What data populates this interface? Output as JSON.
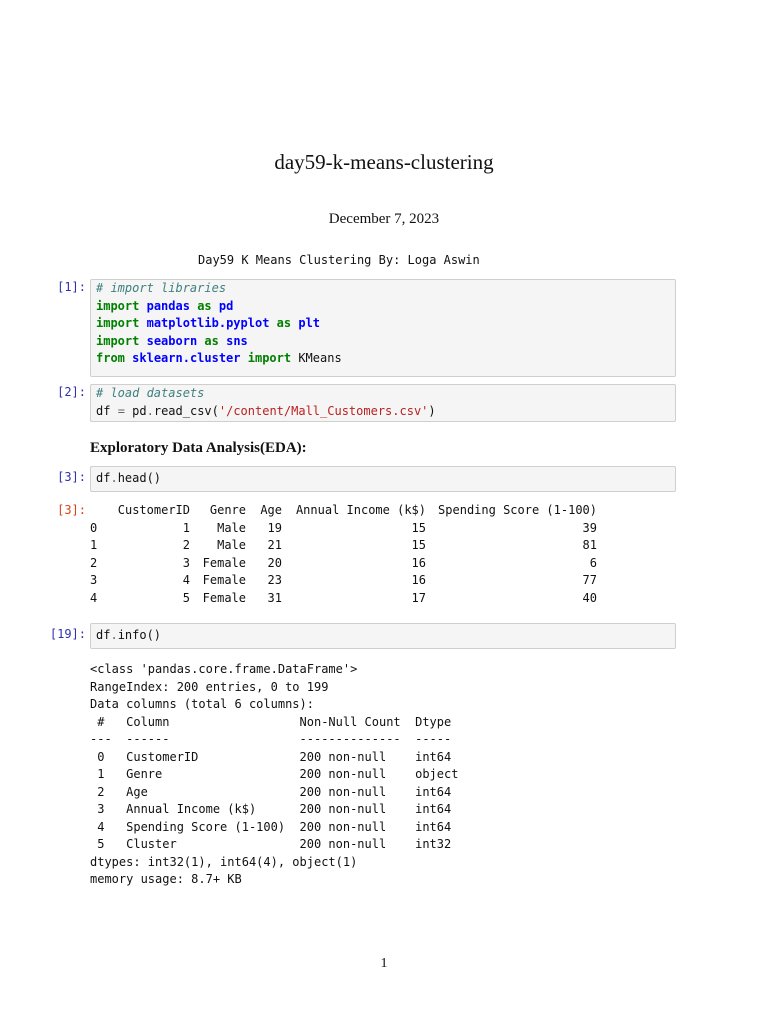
{
  "title": "day59-k-means-clustering",
  "date": "December 7, 2023",
  "intro": "Day59 K Means Clustering By: Loga Aswin",
  "cells": [
    {
      "prompt": "[1]:",
      "lines": [
        [
          {
            "t": "# import libraries",
            "c": "cm"
          }
        ],
        [
          {
            "t": "import",
            "c": "kw"
          },
          {
            "t": " ",
            "c": "tx"
          },
          {
            "t": "pandas",
            "c": "nm"
          },
          {
            "t": " ",
            "c": "tx"
          },
          {
            "t": "as",
            "c": "kw"
          },
          {
            "t": " ",
            "c": "tx"
          },
          {
            "t": "pd",
            "c": "nm"
          }
        ],
        [
          {
            "t": "import",
            "c": "kw"
          },
          {
            "t": " ",
            "c": "tx"
          },
          {
            "t": "matplotlib.pyplot",
            "c": "nm"
          },
          {
            "t": " ",
            "c": "tx"
          },
          {
            "t": "as",
            "c": "kw"
          },
          {
            "t": " ",
            "c": "tx"
          },
          {
            "t": "plt",
            "c": "nm"
          }
        ],
        [
          {
            "t": "import",
            "c": "kw"
          },
          {
            "t": " ",
            "c": "tx"
          },
          {
            "t": "seaborn",
            "c": "nm"
          },
          {
            "t": " ",
            "c": "tx"
          },
          {
            "t": "as",
            "c": "kw"
          },
          {
            "t": " ",
            "c": "tx"
          },
          {
            "t": "sns",
            "c": "nm"
          }
        ],
        [
          {
            "t": "from",
            "c": "kw"
          },
          {
            "t": " ",
            "c": "tx"
          },
          {
            "t": "sklearn.cluster",
            "c": "nm"
          },
          {
            "t": " ",
            "c": "tx"
          },
          {
            "t": "import",
            "c": "kw"
          },
          {
            "t": " KMeans",
            "c": "tx"
          }
        ]
      ]
    },
    {
      "prompt": "[2]:",
      "lines": [
        [
          {
            "t": "# load datasets",
            "c": "cm"
          }
        ],
        [
          {
            "t": "df ",
            "c": "tx"
          },
          {
            "t": "=",
            "c": "op"
          },
          {
            "t": " pd",
            "c": "tx"
          },
          {
            "t": ".",
            "c": "op"
          },
          {
            "t": "read_csv(",
            "c": "tx"
          },
          {
            "t": "'/content/Mall_Customers.csv'",
            "c": "st"
          },
          {
            "t": ")",
            "c": "tx"
          }
        ]
      ]
    },
    {
      "prompt": "[3]:",
      "lines": [
        [
          {
            "t": "df",
            "c": "tx"
          },
          {
            "t": ".",
            "c": "op"
          },
          {
            "t": "head()",
            "c": "tx"
          }
        ]
      ]
    },
    {
      "prompt": "[19]:",
      "lines": [
        [
          {
            "t": "df",
            "c": "tx"
          },
          {
            "t": ".",
            "c": "op"
          },
          {
            "t": "info()",
            "c": "tx"
          }
        ]
      ]
    }
  ],
  "eda_heading": "Exploratory Data Analysis(EDA):",
  "head_output": {
    "prompt": "[3]:",
    "columns": [
      "",
      "CustomerID",
      "Genre",
      "Age",
      "Annual Income (k$)",
      "Spending Score (1-100)"
    ],
    "rows": [
      [
        "0",
        "1",
        "Male",
        "19",
        "15",
        "39"
      ],
      [
        "1",
        "2",
        "Male",
        "21",
        "15",
        "81"
      ],
      [
        "2",
        "3",
        "Female",
        "20",
        "16",
        "6"
      ],
      [
        "3",
        "4",
        "Female",
        "23",
        "16",
        "77"
      ],
      [
        "4",
        "5",
        "Female",
        "31",
        "17",
        "40"
      ]
    ]
  },
  "info_output": [
    "<class 'pandas.core.frame.DataFrame'>",
    "RangeIndex: 200 entries, 0 to 199",
    "Data columns (total 6 columns):",
    " #   Column                  Non-Null Count  Dtype ",
    "---  ------                  --------------  ----- ",
    " 0   CustomerID              200 non-null    int64 ",
    " 1   Genre                   200 non-null    object",
    " 2   Age                     200 non-null    int64 ",
    " 3   Annual Income (k$)      200 non-null    int64 ",
    " 4   Spending Score (1-100)  200 non-null    int64 ",
    " 5   Cluster                 200 non-null    int32 ",
    "dtypes: int32(1), int64(4), object(1)",
    "memory usage: 8.7+ KB"
  ],
  "page_number": "1"
}
